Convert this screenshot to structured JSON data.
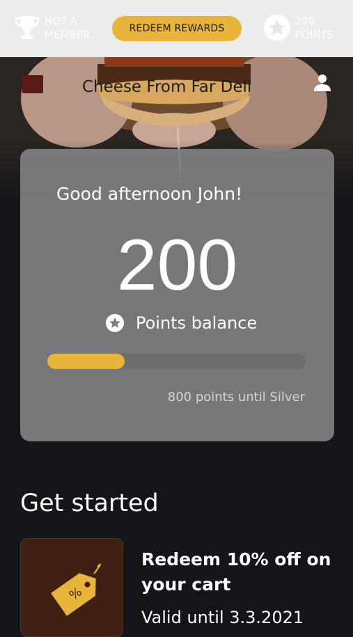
{
  "topbar": {
    "membership_line1": "NOT A",
    "membership_line2": "MEMBER",
    "redeem_button": "REDEEM REWARDS",
    "points_line1": "200",
    "points_line2": "POINTS",
    "icons": {
      "membership": "trophy-icon",
      "points": "star-badge-icon"
    }
  },
  "header": {
    "restaurant_name": "Cheese From Far  Deli",
    "icons": {
      "profile": "person-icon"
    }
  },
  "points_card": {
    "greeting": "Good afternoon John!",
    "points": "200",
    "balance_label": "Points balance",
    "progress_fraction": 0.3,
    "until_next_tier": "800 points until Silver"
  },
  "get_started": {
    "title": "Get started",
    "offers": [
      {
        "title": "Redeem 10% off on your cart",
        "valid": "Valid until 3.3.2021",
        "icon": "discount-tag-icon"
      }
    ]
  },
  "colors": {
    "accent": "#e8b43a",
    "background": "#14151a",
    "card": "#808082"
  }
}
